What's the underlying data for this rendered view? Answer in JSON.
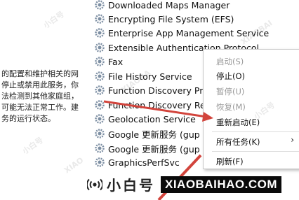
{
  "description_lines": [
    "的配置和维护相关的网",
    "停止或禁用此服务，你",
    "法检测到其他家庭组，",
    "可能无法正常工作。建",
    "务的运行状态。"
  ],
  "services": [
    "Downloaded Maps Manager",
    "Encrypting File System (EFS)",
    "Enterprise App Management Service",
    "Extensible Authentication Protocol",
    "Fax",
    "File History Service",
    "Function Discovery Pr",
    "Function Discovery Re",
    "Geolocation Service",
    "Google 更新服务 (gup",
    "Google 更新服务 (gup",
    "GraphicsPerfSvc"
  ],
  "context_menu": {
    "start": "启动(S)",
    "stop": "停止(O)",
    "pause": "暂停(U)",
    "resume": "恢复(M)",
    "restart": "重新启动(E)",
    "all_tasks": "所有任务(K)",
    "all_tasks_arrow": "›",
    "refresh": "刷新(F)"
  },
  "footer": {
    "name": "小白号",
    "url": "XIAOBAIHAO.COM"
  },
  "watermark_texts": [
    "小白号",
    "XIAOBAI",
    "小白号",
    "XIAOBA",
    "小白号",
    "XIAO"
  ],
  "colors": {
    "arrow": "#d2443c",
    "gear": "#7d8fa3",
    "footer_bg": "#0a0a0a"
  }
}
